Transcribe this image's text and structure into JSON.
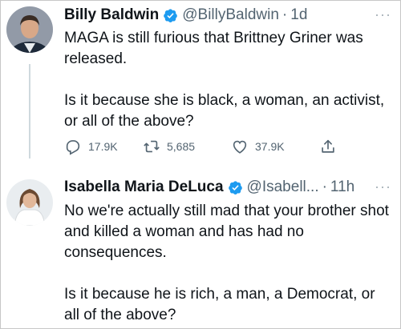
{
  "tweets": [
    {
      "author_name": "Billy Baldwin",
      "handle": "@BillyBaldwin",
      "separator": "·",
      "time": "1d",
      "more": "···",
      "paragraphs": [
        "MAGA is still furious that Brittney Griner was released.",
        "Is it because she is black, a woman, an activist, or all of the above?"
      ],
      "replies": "17.9K",
      "retweets": "5,685",
      "likes": "37.9K"
    },
    {
      "author_name": "Isabella Maria DeLuca",
      "handle": "@Isabell...",
      "separator": "·",
      "time": "11h",
      "more": "···",
      "paragraphs": [
        "No we're actually still mad that your brother shot and killed a woman and has had no consequences.",
        "Is it because he is rich, a man, a Democrat, or all of the above?"
      ]
    }
  ],
  "colors": {
    "verified_blue": "#1d9bf0",
    "secondary_text": "#536471",
    "thread_line": "#cfd9de"
  }
}
